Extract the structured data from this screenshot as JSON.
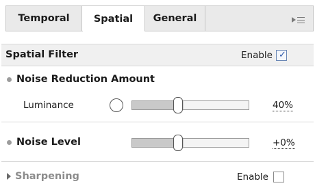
{
  "tabs": [
    {
      "label": "Temporal",
      "active": false
    },
    {
      "label": "Spatial",
      "active": true
    },
    {
      "label": "General",
      "active": false
    }
  ],
  "spatial_filter": {
    "title": "Spatial Filter",
    "enable_label": "Enable",
    "enabled": true
  },
  "noise_reduction": {
    "title": "Noise Reduction Amount",
    "luminance_label": "Luminance",
    "luminance_value": "40%",
    "luminance_fraction": 0.4
  },
  "noise_level": {
    "title": "Noise Level",
    "value": "+0%",
    "fraction": 0.4
  },
  "sharpening": {
    "title": "Sharpening",
    "enable_label": "Enable",
    "enabled": false
  },
  "colors": {
    "accent_check": "#2a56a8",
    "header_bg": "#f0f0f0",
    "tab_bg": "#eaeaea"
  }
}
